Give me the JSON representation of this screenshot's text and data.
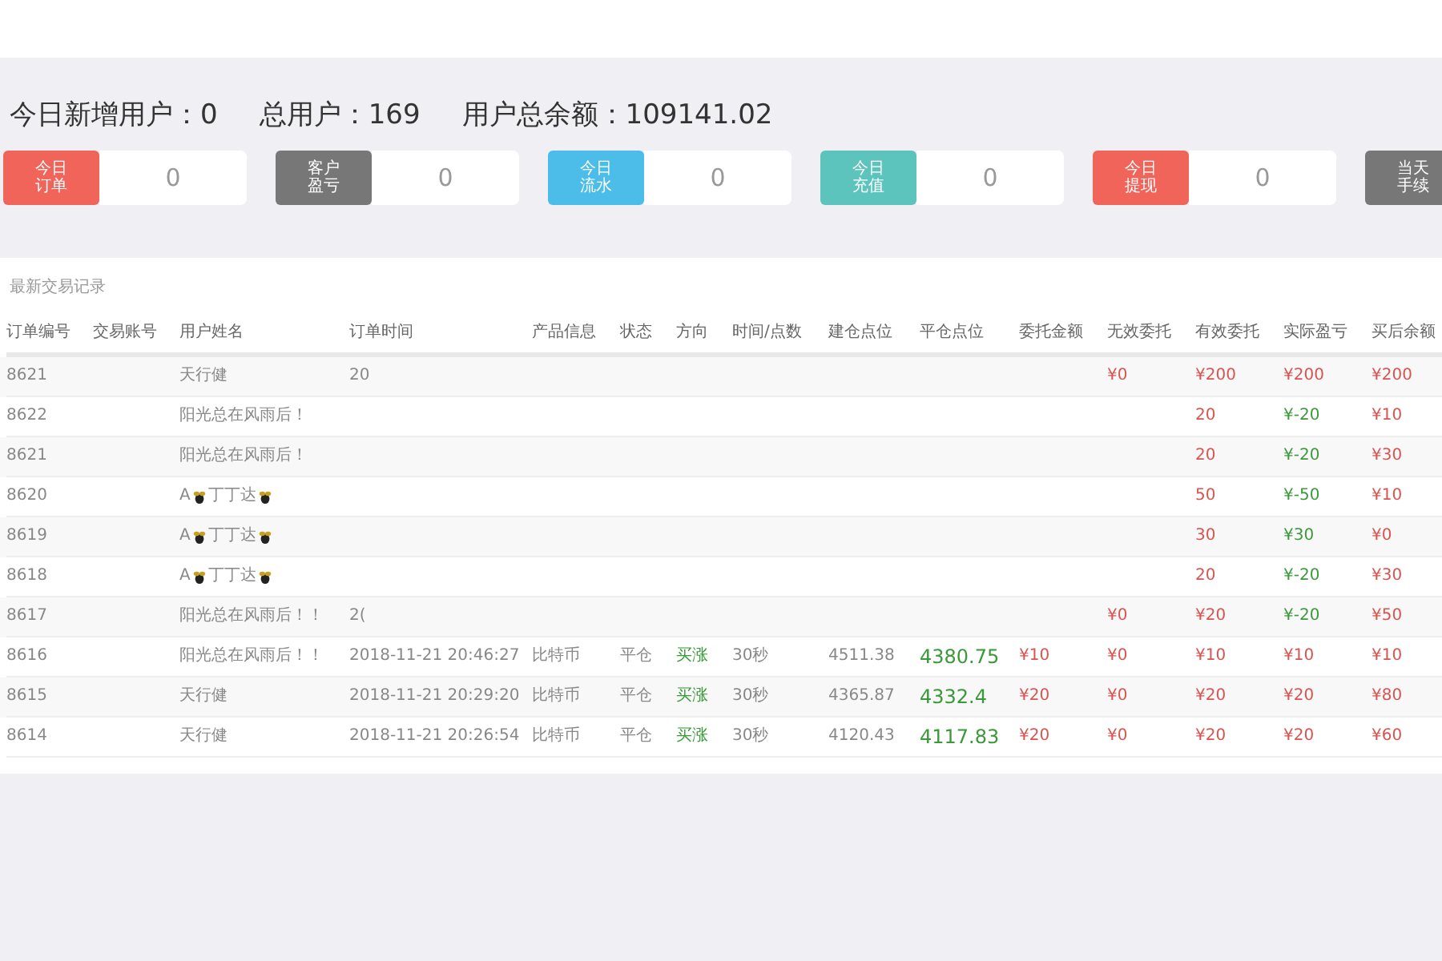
{
  "totals": [
    {
      "label": "今日新增用户：",
      "value": "0"
    },
    {
      "label": "总用户：",
      "value": "169"
    },
    {
      "label": "用户总余额：",
      "value": "109141.02"
    }
  ],
  "cards": [
    {
      "label": [
        "今日",
        "订单"
      ],
      "value": "0",
      "color": "#f0645a"
    },
    {
      "label": [
        "客户",
        "盈亏"
      ],
      "value": "0",
      "color": "#777777"
    },
    {
      "label": [
        "今日",
        "流水"
      ],
      "value": "0",
      "color": "#4bbde8"
    },
    {
      "label": [
        "今日",
        "充值"
      ],
      "value": "0",
      "color": "#5cc3bd"
    },
    {
      "label": [
        "今日",
        "提现"
      ],
      "value": "0",
      "color": "#f0645a"
    },
    {
      "label": [
        "当天",
        "手续"
      ],
      "color": "#777777"
    }
  ],
  "table": {
    "title": "最新交易记录",
    "columns": [
      "订单编号",
      "交易账号",
      "用户姓名",
      "订单时间",
      "产品信息",
      "状态",
      "方向",
      "时间/点数",
      "建仓点位",
      "平仓点位",
      "委托金额",
      "无效委托",
      "有效委托",
      "实际盈亏",
      "买后余额"
    ],
    "rows": [
      {
        "id": "8621",
        "user": [
          "天行健"
        ],
        "time": "20",
        "invalid": "¥0",
        "valid": "¥200",
        "actual": "¥200",
        "win": true,
        "after": "¥200"
      },
      {
        "id": "8622",
        "user": [
          "阳光总在风雨后！"
        ],
        "valid": "20",
        "actual": "¥-20",
        "win": false,
        "after": "¥10"
      },
      {
        "id": "8621",
        "user": [
          "阳光总在风雨后！"
        ],
        "valid": "20",
        "actual": "¥-20",
        "win": false,
        "after": "¥30"
      },
      {
        "id": "8620",
        "user": [
          "A",
          "丁丁达"
        ],
        "valid": "50",
        "actual": "¥-50",
        "win": false,
        "after": "¥10"
      },
      {
        "id": "8619",
        "user": [
          "A",
          "丁丁达"
        ],
        "valid": "30",
        "actual": "¥30",
        "win": false,
        "after": "¥0"
      },
      {
        "id": "8618",
        "user": [
          "A",
          "丁丁达"
        ],
        "valid": "20",
        "actual": "¥-20",
        "win": false,
        "after": "¥30"
      },
      {
        "id": "8617",
        "user": [
          "阳光总在风雨后！！"
        ],
        "time": "2(",
        "invalid": "¥0",
        "valid": "¥20",
        "actual": "¥-20",
        "win": false,
        "after": "¥50"
      },
      {
        "id": "8616",
        "user": [
          "阳光总在风雨后！！"
        ],
        "time": "2018-11-21 20:46:27",
        "product": "比特币",
        "state": "平仓",
        "direction": "买涨",
        "period": "30秒",
        "open": "4511.38",
        "close": "4380.75",
        "amount": "¥10",
        "invalid": "¥0",
        "valid": "¥10",
        "actual": "¥10",
        "win": true,
        "after": "¥10"
      },
      {
        "id": "8615",
        "user": [
          "天行健"
        ],
        "time": "2018-11-21 20:29:20",
        "product": "比特币",
        "state": "平仓",
        "direction": "买涨",
        "period": "30秒",
        "open": "4365.87",
        "close": "4332.4",
        "amount": "¥20",
        "invalid": "¥0",
        "valid": "¥20",
        "actual": "¥20",
        "win": true,
        "after": "¥80"
      },
      {
        "id": "8614",
        "user": [
          "天行健"
        ],
        "time": "2018-11-21 20:26:54",
        "product": "比特币",
        "state": "平仓",
        "direction": "买涨",
        "period": "30秒",
        "open": "4120.43",
        "close": "4117.83",
        "amount": "¥20",
        "invalid": "¥0",
        "valid": "¥20",
        "actual": "¥20",
        "win": true,
        "after": "¥60"
      }
    ]
  }
}
